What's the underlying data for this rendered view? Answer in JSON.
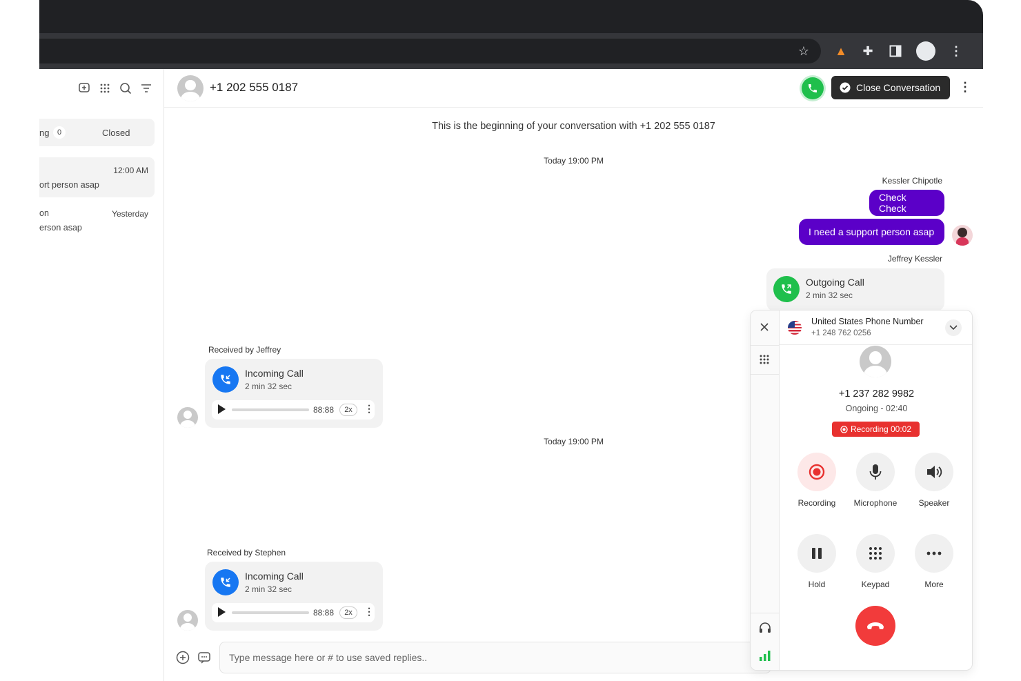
{
  "browser": {
    "icons": [
      "star-icon",
      "fox-extension-icon",
      "puzzle-extension-icon",
      "sidepanel-icon",
      "profile-avatar",
      "menu-dots-icon"
    ]
  },
  "sidebar": {
    "filter": {
      "left_label": "ng",
      "count": "0",
      "closed_label": "Closed"
    },
    "conversations": [
      {
        "time": "12:00 AM",
        "preview": "ort person asap"
      },
      {
        "name": "on",
        "time": "Yesterday",
        "preview": "erson asap"
      }
    ]
  },
  "header": {
    "phone": "+1 202 555 0187",
    "close_label": "Close Conversation"
  },
  "thread": {
    "beginning_note": "This is the beginning of your conversation with +1 202 555 0187",
    "timestamp_1": "Today 19:00 PM",
    "sender_1": "Kessler Chipotle",
    "msg_1": "Check Check",
    "msg_2": "I need a support person asap",
    "sender_2": "Jeffrey Kessler",
    "outgoing": {
      "title": "Outgoing Call",
      "duration": "2 min 32 sec"
    },
    "received_1": "Received by Jeffrey",
    "incoming_1": {
      "title": "Incoming Call",
      "duration": "2 min 32 sec",
      "time": "88:88",
      "speed": "2x"
    },
    "timestamp_2": "Today 19:00 PM",
    "received_2": "Received by Stephen",
    "incoming_2": {
      "title": "Incoming Call",
      "duration": "2 min 32 sec",
      "time": "88:88",
      "speed": "2x"
    }
  },
  "composer": {
    "placeholder": "Type message here or # to use saved replies.."
  },
  "dialer": {
    "line_name": "United States Phone Number",
    "line_number": "+1 248 762 0256",
    "caller": "+1 237 282 9982",
    "status": "Ongoing - 02:40",
    "recording_badge": "Recording 00:02",
    "buttons": {
      "recording": "Recording",
      "microphone": "Microphone",
      "speaker": "Speaker",
      "hold": "Hold",
      "keypad": "Keypad",
      "more": "More"
    }
  },
  "colors": {
    "accent_purple": "#5b00c8",
    "call_green": "#1fbf4c",
    "incoming_blue": "#1777f2",
    "hangup_red": "#f23b3b",
    "record_red": "#e8312f"
  }
}
